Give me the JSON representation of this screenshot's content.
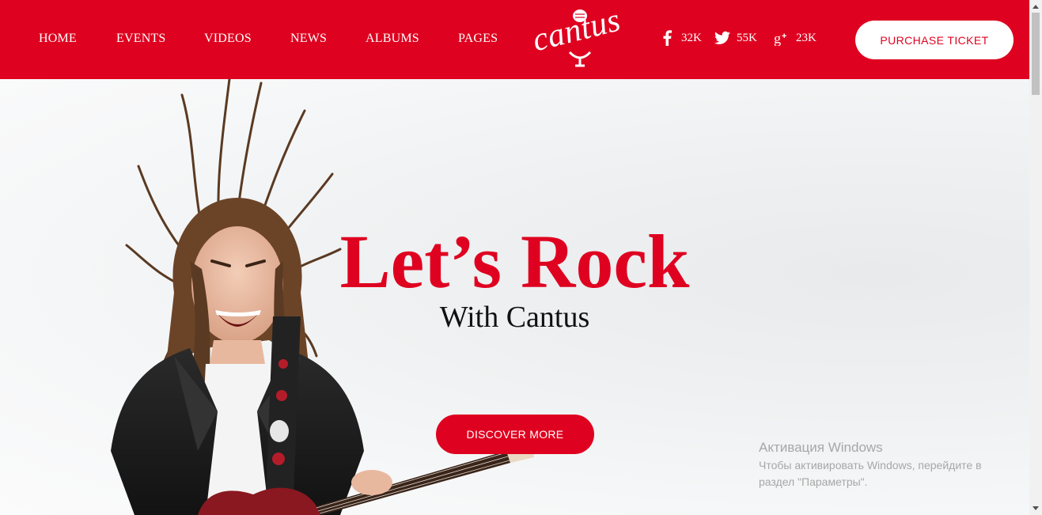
{
  "nav": {
    "items": [
      {
        "label": "HOME"
      },
      {
        "label": "EVENTS"
      },
      {
        "label": "VIDEOS"
      },
      {
        "label": "NEWS"
      },
      {
        "label": "ALBUMS"
      },
      {
        "label": "PAGES"
      }
    ]
  },
  "logo": {
    "text": "cantus",
    "icon": "microphone-icon"
  },
  "social": [
    {
      "icon": "facebook-icon",
      "count": "32K"
    },
    {
      "icon": "twitter-icon",
      "count": "55K"
    },
    {
      "icon": "google-plus-icon",
      "count": "23K"
    }
  ],
  "header": {
    "ticket_label": "PURCHASE TICKET"
  },
  "hero": {
    "headline": "Let’s Rock",
    "subline": "With Cantus",
    "cta_label": "DISCOVER MORE"
  },
  "windows_activation": {
    "title": "Активация Windows",
    "message": "Чтобы активировать Windows, перейдите в раздел \"Параметры\"."
  },
  "colors": {
    "brand_red": "#df0220",
    "white": "#ffffff"
  }
}
